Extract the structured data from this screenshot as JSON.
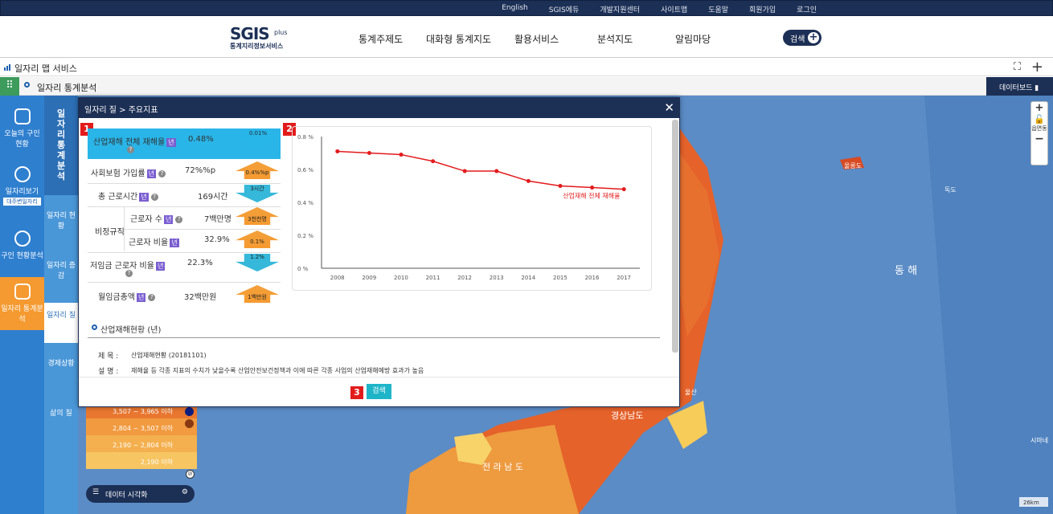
{
  "top_links": [
    "English",
    "SGIS에듀",
    "개발지원센터",
    "사이트맵",
    "도움말",
    "회원가입",
    "로그인"
  ],
  "logo": {
    "main": "SGIS",
    "plus": "plus",
    "sub": "통계지리정보서비스"
  },
  "gnb": [
    "통계주제도",
    "대화형 통계지도",
    "활용서비스",
    "분석지도",
    "알림마당"
  ],
  "search_label": "검색",
  "page_title": "일자리 맵 서비스",
  "sub_title": "일자리 통계분석",
  "dashboard_label": "데이터보드",
  "sidebar": [
    "오늘의 구인 현황",
    "일자리보기",
    "대주변일자리",
    "구인 현황분석",
    "일자리 통계분석"
  ],
  "sub_title_vertical": "일자리통계분석",
  "submenu": [
    "일자리 현황",
    "일자리 증감",
    "일자리 질",
    "경제상황",
    "삶의 질"
  ],
  "dialog": {
    "title": "일자리 질 > 주요지표",
    "indicators": [
      {
        "label": "산업재해 전체 재해율",
        "unit_badge": "년",
        "value": "0.48%",
        "delta": "0.01%",
        "dir": "down"
      },
      {
        "label": "사회보험 가입률",
        "unit_badge": "년",
        "value": "72%%p",
        "delta": "0.4%%p",
        "dir": "up"
      },
      {
        "label": "총 근로시간",
        "unit_badge": "년",
        "value": "169시간",
        "delta": "3시간",
        "dir": "down"
      },
      {
        "label": "근로자 수",
        "unit_badge": "년",
        "value": "7백만명",
        "delta": "3천천명",
        "dir": "up"
      },
      {
        "label": "근로자 비율",
        "unit_badge": "년",
        "value": "32.9%",
        "delta": "0.1%",
        "dir": "up"
      },
      {
        "label": "저임금 근로자 비율",
        "unit_badge": "년",
        "value": "22.3%",
        "delta": "1.2%",
        "dir": "down"
      },
      {
        "label": "월임금총액",
        "unit_badge": "년",
        "value": "32백만원",
        "delta": "1백만원",
        "dir": "up"
      }
    ],
    "group_label": "비정규직",
    "info_title": "산업재해현황 (년)",
    "info": {
      "subject_label": "제 목 :",
      "subject": "산업재해현황 (20181101)",
      "desc_label": "설 명 :",
      "desc": "재해율 등 각종 지표의 수치가 낮을수록 산업안전보건정책과 이에 따른 각종 사업의 산업재해예방 효과가 높음"
    },
    "search_button": "검색",
    "badges": [
      "1",
      "2",
      "3"
    ]
  },
  "legend": {
    "rows": [
      "3,507 ~ 3,965 이하",
      "2,804 ~ 3,507 이하",
      "2,190 ~ 2,804 이하",
      "2,190 이하"
    ],
    "colors": [
      "#e9772f",
      "#f19a3f",
      "#f4b04f",
      "#f7c562"
    ],
    "button": "데이터 시각화"
  },
  "map_labels": [
    "울릉도",
    "독도",
    "동 해",
    "경상남도",
    "전 라 남 도",
    "울산",
    "시마네",
    "26km"
  ],
  "chart_data": {
    "type": "line",
    "x": [
      "2008",
      "2009",
      "2010",
      "2011",
      "2012",
      "2013",
      "2014",
      "2015",
      "2016",
      "2017"
    ],
    "series": [
      {
        "name": "산업재해 전체 재해율",
        "values": [
          0.71,
          0.7,
          0.69,
          0.65,
          0.59,
          0.59,
          0.53,
          0.5,
          0.49,
          0.48
        ],
        "color": "#e31a1c"
      }
    ],
    "yticks": [
      "0 %",
      "0.2 %",
      "0.4 %",
      "0.6 %",
      "0.8 %"
    ],
    "ylim": [
      0,
      0.8
    ]
  }
}
